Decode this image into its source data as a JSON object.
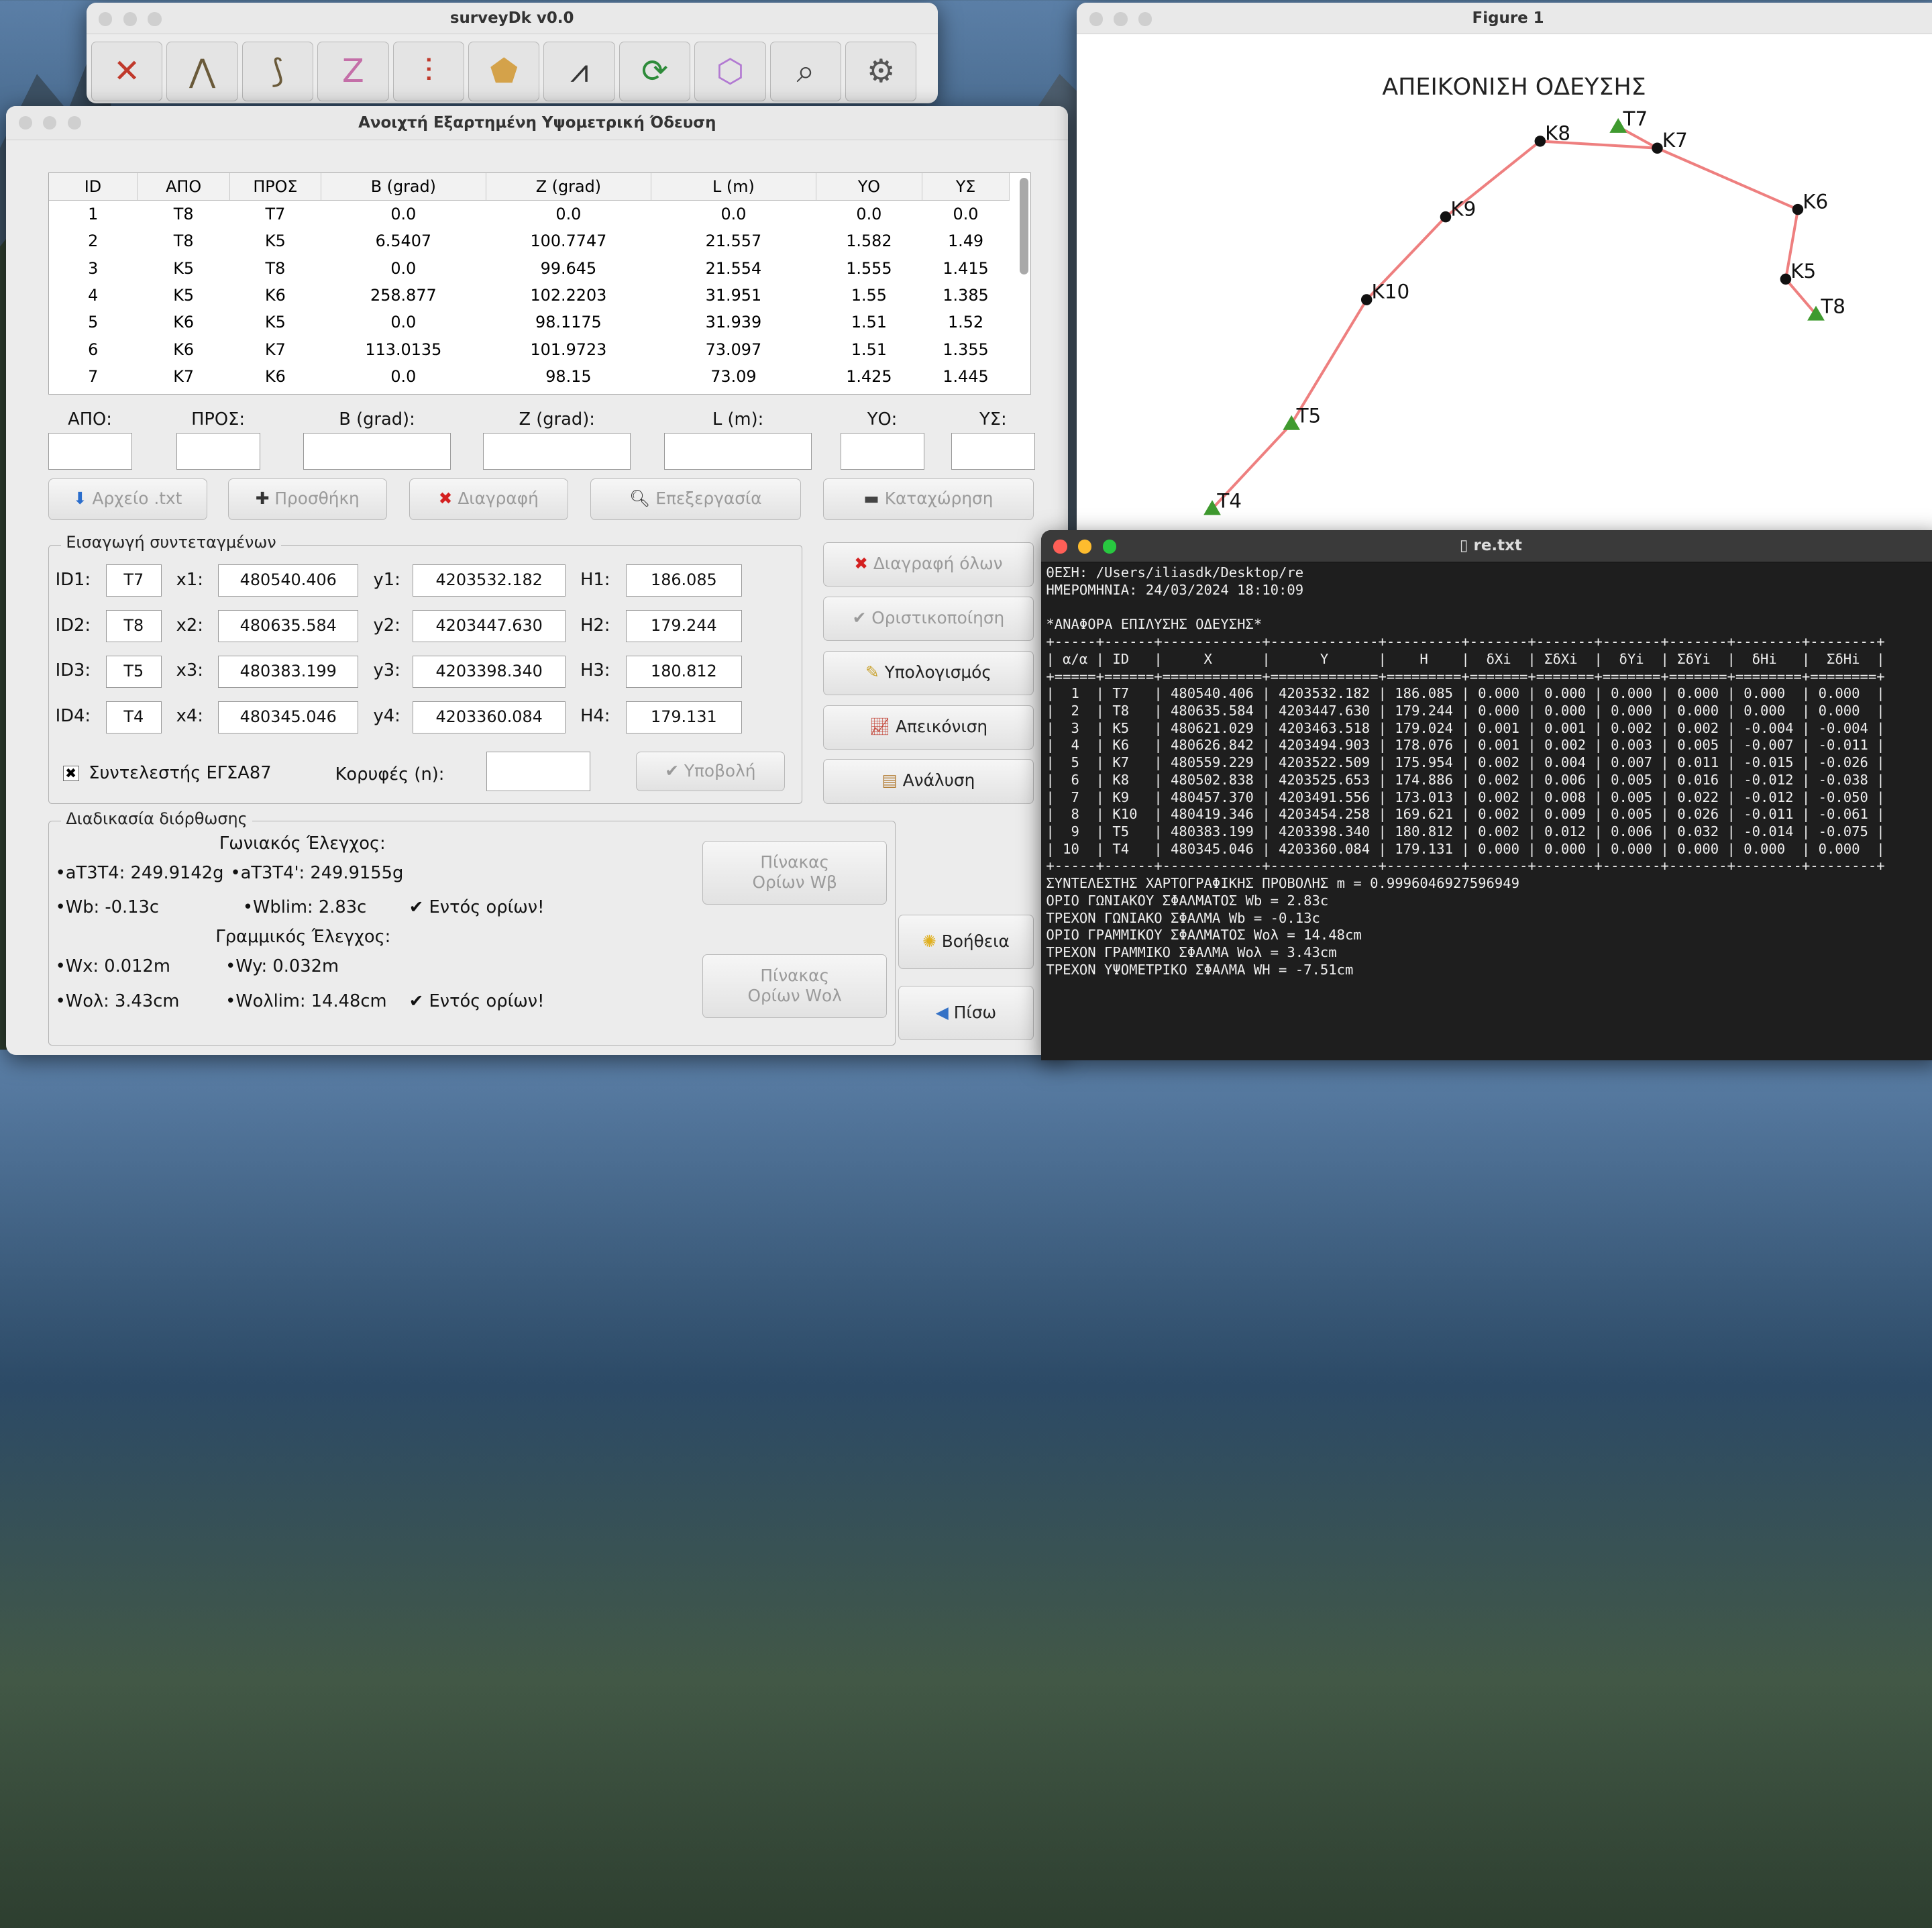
{
  "toolbar": {
    "title": "surveyDk v0.0",
    "icons": [
      "tools-icon",
      "triangulation-icon",
      "resection-icon",
      "traverse-icon",
      "leveling-icon",
      "area-polygon-icon",
      "compass-icon",
      "transform-icon",
      "closed-traverse-icon",
      "inspect-icon",
      "settings-icon"
    ]
  },
  "dialog": {
    "title": "Ανοιχτή Εξαρτημένη Υψομετρική Όδευση",
    "table": {
      "headers": [
        "ID",
        "ΑΠΟ",
        "ΠΡΟΣ",
        "Β (grad)",
        "Ζ (grad)",
        "L (m)",
        "ΥΟ",
        "ΥΣ"
      ],
      "rows": [
        [
          "1",
          "T8",
          "T7",
          "0.0",
          "0.0",
          "0.0",
          "0.0",
          "0.0"
        ],
        [
          "2",
          "T8",
          "K5",
          "6.5407",
          "100.7747",
          "21.557",
          "1.582",
          "1.49"
        ],
        [
          "3",
          "K5",
          "T8",
          "0.0",
          "99.645",
          "21.554",
          "1.555",
          "1.415"
        ],
        [
          "4",
          "K5",
          "K6",
          "258.877",
          "102.2203",
          "31.951",
          "1.55",
          "1.385"
        ],
        [
          "5",
          "K6",
          "K5",
          "0.0",
          "98.1175",
          "31.939",
          "1.51",
          "1.52"
        ],
        [
          "6",
          "K6",
          "K7",
          "113.0135",
          "101.9723",
          "73.097",
          "1.51",
          "1.355"
        ],
        [
          "7",
          "K7",
          "K6",
          "0.0",
          "98.15",
          "73.09",
          "1.425",
          "1.445"
        ]
      ]
    },
    "entry": {
      "labels": [
        "ΑΠΟ:",
        "ΠΡΟΣ:",
        "Β (grad):",
        "Ζ (grad):",
        "L (m):",
        "ΥΟ:",
        "ΥΣ:"
      ]
    },
    "buttons": {
      "file": "Αρχείο .txt",
      "add": "Προσθήκη",
      "delete": "Διαγραφή",
      "edit": "Επεξεργασία",
      "register": "Καταχώρηση",
      "delete_all": "Διαγραφή όλων",
      "finalize": "Οριστικοποίηση",
      "compute": "Υπολογισμός",
      "plot": "Απεικόνιση",
      "analysis": "Ανάλυση",
      "help": "Βοήθεια",
      "back": "Πίσω",
      "submit": "Υποβολή",
      "table_wb": "Πίνακας\nΟρίων Wβ",
      "table_wol": "Πίνακας\nΟρίων Wολ"
    },
    "coords": {
      "title": "Εισαγωγή συντεταγμένων",
      "rows": [
        {
          "id_label": "ID1:",
          "id": "T7",
          "x_label": "x1:",
          "x": "480540.406",
          "y_label": "y1:",
          "y": "4203532.182",
          "h_label": "H1:",
          "h": "186.085"
        },
        {
          "id_label": "ID2:",
          "id": "T8",
          "x_label": "x2:",
          "x": "480635.584",
          "y_label": "y2:",
          "y": "4203447.630",
          "h_label": "H2:",
          "h": "179.244"
        },
        {
          "id_label": "ID3:",
          "id": "T5",
          "x_label": "x3:",
          "x": "480383.199",
          "y_label": "y3:",
          "y": "4203398.340",
          "h_label": "H3:",
          "h": "180.812"
        },
        {
          "id_label": "ID4:",
          "id": "T4",
          "x_label": "x4:",
          "x": "480345.046",
          "y_label": "y4:",
          "y": "4203360.084",
          "h_label": "H4:",
          "h": "179.131"
        }
      ],
      "checkbox_label": "Συντελεστής ΕΓΣΑ87",
      "checkbox_checked": true,
      "vertices_label": "Κορυφές (n):"
    },
    "correction": {
      "title": "Διαδικασία διόρθωσης",
      "angular_title": "Γωνιακός Έλεγχος:",
      "a1": "•aT3T4: 249.9142g",
      "a2": "•aT3T4': 249.9155g",
      "wb": "•Wb: -0.13c",
      "wblim": "•Wblim: 2.83c",
      "within": "✔ Εντός ορίων!",
      "linear_title": "Γραμμικός Έλεγχος:",
      "wx": "•Wx: 0.012m",
      "wy": "•Wy: 0.032m",
      "wol": "•Wολ: 3.43cm",
      "wollim": "•Wολlim: 14.48cm"
    }
  },
  "figure": {
    "window_title": "Figure 1",
    "title": "ΑΠΕΙΚΟΝΙΣΗ ΟΔΕΥΣΗΣ",
    "line_color": "#ee7f7f",
    "control_color": "#3f9a2f",
    "points": [
      {
        "id": "T4",
        "x": 480345.046,
        "y": 4203360.084,
        "control": true
      },
      {
        "id": "T5",
        "x": 480383.199,
        "y": 4203398.34,
        "control": true
      },
      {
        "id": "K10",
        "x": 480419.346,
        "y": 4203454.258,
        "control": false
      },
      {
        "id": "K9",
        "x": 480457.37,
        "y": 4203491.556,
        "control": false
      },
      {
        "id": "K8",
        "x": 480502.838,
        "y": 4203525.653,
        "control": false
      },
      {
        "id": "K7",
        "x": 480559.229,
        "y": 4203522.509,
        "control": false
      },
      {
        "id": "K6",
        "x": 480626.842,
        "y": 4203494.903,
        "control": false
      },
      {
        "id": "K5",
        "x": 480621.029,
        "y": 4203463.518,
        "control": false
      },
      {
        "id": "T8",
        "x": 480635.584,
        "y": 4203447.63,
        "control": true
      },
      {
        "id": "T7",
        "x": 480540.406,
        "y": 4203532.182,
        "control": true
      }
    ]
  },
  "terminal": {
    "title": "re.txt",
    "lines": [
      "ΘΕΣΗ: /Users/iliasdk/Desktop/re",
      "ΗΜΕΡΟΜΗΝΙΑ: 24/03/2024 18:10:09",
      "",
      "*ΑΝΑΦΟΡΑ ΕΠΙΛΥΣΗΣ ΟΔΕΥΣΗΣ*",
      "+-----+------+------------+-------------+---------+-------+-------+-------+-------+--------+--------+",
      "| α/α | ID   |     X      |      Y      |    H    |  δXi  | ΣδXi  |  δYi  | ΣδYi  |  δHi   |  ΣδHi  |",
      "+=====+======+============+=============+=========+=======+=======+=======+=======+========+========+",
      "|  1  | T7   | 480540.406 | 4203532.182 | 186.085 | 0.000 | 0.000 | 0.000 | 0.000 | 0.000  | 0.000  |",
      "|  2  | T8   | 480635.584 | 4203447.630 | 179.244 | 0.000 | 0.000 | 0.000 | 0.000 | 0.000  | 0.000  |",
      "|  3  | K5   | 480621.029 | 4203463.518 | 179.024 | 0.001 | 0.001 | 0.002 | 0.002 | -0.004 | -0.004 |",
      "|  4  | K6   | 480626.842 | 4203494.903 | 178.076 | 0.001 | 0.002 | 0.003 | 0.005 | -0.007 | -0.011 |",
      "|  5  | K7   | 480559.229 | 4203522.509 | 175.954 | 0.002 | 0.004 | 0.007 | 0.011 | -0.015 | -0.026 |",
      "|  6  | K8   | 480502.838 | 4203525.653 | 174.886 | 0.002 | 0.006 | 0.005 | 0.016 | -0.012 | -0.038 |",
      "|  7  | K9   | 480457.370 | 4203491.556 | 173.013 | 0.002 | 0.008 | 0.005 | 0.022 | -0.012 | -0.050 |",
      "|  8  | K10  | 480419.346 | 4203454.258 | 169.621 | 0.002 | 0.009 | 0.005 | 0.026 | -0.011 | -0.061 |",
      "|  9  | T5   | 480383.199 | 4203398.340 | 180.812 | 0.002 | 0.012 | 0.006 | 0.032 | -0.014 | -0.075 |",
      "| 10  | T4   | 480345.046 | 4203360.084 | 179.131 | 0.000 | 0.000 | 0.000 | 0.000 | 0.000  | 0.000  |",
      "+-----+------+------------+-------------+---------+-------+-------+-------+-------+--------+--------+",
      "ΣΥΝΤΕΛΕΣΤΗΣ ΧΑΡΤΟΓΡΑΦΙΚΗΣ ΠΡΟΒΟΛΗΣ m = 0.9996046927596949",
      "ΟΡΙΟ ΓΩΝΙΑΚΟΥ ΣΦΑΛΜΑΤΟΣ Wb = 2.83c",
      "ΤΡΕΧΟΝ ΓΩΝΙΑΚΟ ΣΦΑΛΜΑ Wb = -0.13c",
      "ΟΡΙΟ ΓΡΑΜΜΙΚΟΥ ΣΦΑΛΜΑΤΟΣ Wολ = 14.48cm",
      "ΤΡΕΧΟΝ ΓΡΑΜΜΙΚΟ ΣΦΑΛΜΑ Wολ = 3.43cm",
      "ΤΡΕΧΟΝ ΥΨΟΜΕΤΡΙΚΟ ΣΦΑΛΜΑ WH = -7.51cm"
    ]
  }
}
